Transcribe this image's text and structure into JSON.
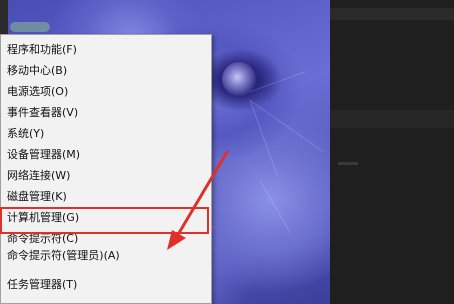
{
  "context_menu": {
    "items": [
      "程序和功能(F)",
      "移动中心(B)",
      "电源选项(O)",
      "事件查看器(V)",
      "系统(Y)",
      "设备管理器(M)",
      "网络连接(W)",
      "磁盘管理(K)",
      "计算机管理(G)",
      "命令提示符(C)",
      "命令提示符(管理员)(A)",
      "任务管理器(T)"
    ],
    "highlighted_item": "命令提示符(管理员)(A)"
  },
  "colors": {
    "annotation": "#e0302a",
    "menu_bg": "#f2f2f2"
  }
}
